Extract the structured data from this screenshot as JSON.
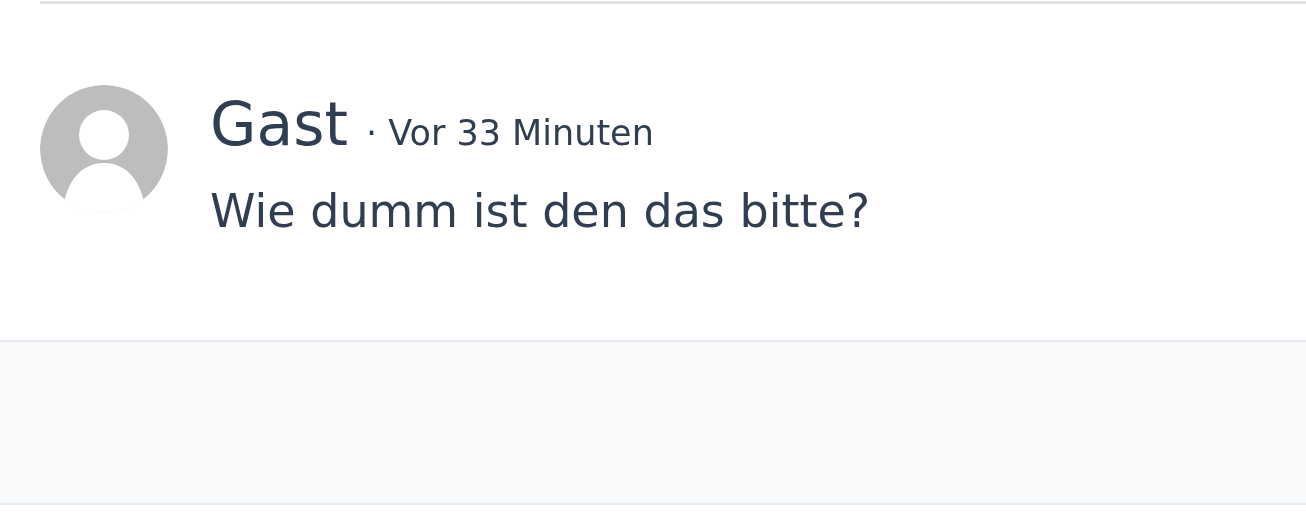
{
  "comment": {
    "author": "Gast",
    "meta": "· Vor 33 Minuten",
    "text": "Wie dumm ist den das bitte?"
  }
}
